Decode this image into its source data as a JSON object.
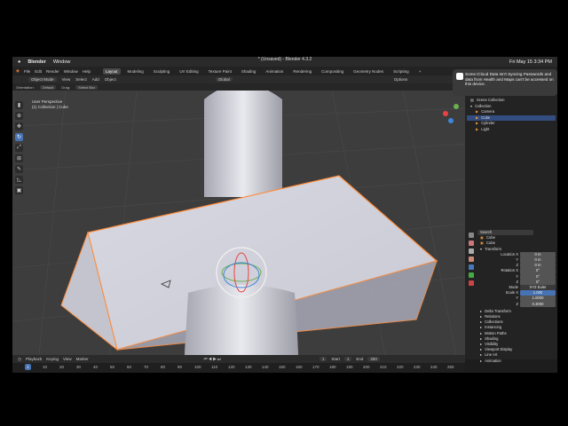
{
  "macbar": {
    "app": "Blender",
    "menu": [
      "Window"
    ],
    "clock": "Fri May 15  3:34 PM"
  },
  "window_title": "* (Unsaved) - Blender 4.3.2",
  "menus": [
    "File",
    "Edit",
    "Render",
    "Window",
    "Help"
  ],
  "workspaces": [
    "Layout",
    "Modeling",
    "Sculpting",
    "UV Editing",
    "Texture Paint",
    "Shading",
    "Animation",
    "Rendering",
    "Compositing",
    "Geometry Nodes",
    "Scripting",
    "+"
  ],
  "active_workspace": "Layout",
  "header": {
    "mode": "Object Mode",
    "view": "View",
    "select": "Select",
    "add": "Add",
    "object": "Object",
    "transform": "Global",
    "options": "Options"
  },
  "header2": {
    "orientation": "Orientation:",
    "orientation_val": "Default",
    "drag": "Drag:",
    "drag_val": "Select Box"
  },
  "viewport": {
    "line1": "User Perspective",
    "line2": "(1) Collection | Cube"
  },
  "notification": {
    "text": "Some iCloud Data Isn't Syncing Passwords and data from Health and Maps can't be accessed on this device."
  },
  "outliner": {
    "header": "Scene Collection",
    "items": [
      {
        "name": "Collection",
        "indent": 0
      },
      {
        "name": "Camera",
        "indent": 1
      },
      {
        "name": "Cube",
        "indent": 1,
        "selected": true
      },
      {
        "name": "Cylinder",
        "indent": 1
      },
      {
        "name": "Light",
        "indent": 1
      }
    ]
  },
  "properties": {
    "search_placeholder": "Search",
    "object_name": "Cube",
    "object_name2": "Cube",
    "transform": "Transform",
    "location": {
      "label": "Location X",
      "x": "0 m",
      "y": "0 m",
      "z": "0 m"
    },
    "rotation": {
      "label": "Rotation X",
      "x": "0°",
      "y": "0°",
      "z": "0°"
    },
    "mode": {
      "label": "Mode",
      "value": "XYZ Euler"
    },
    "scale": {
      "label": "Scale X",
      "x": "1.000",
      "y": "1.0000",
      "z": "0.3000"
    },
    "sections": [
      "Delta Transform",
      "Relations",
      "Collections",
      "Instancing",
      "Motion Paths",
      "Shading",
      "Visibility",
      "Viewport Display",
      "Line Art",
      "Animation"
    ]
  },
  "timeline": {
    "menu": [
      "Playback",
      "Keying",
      "View",
      "Marker"
    ],
    "current": "1",
    "start_label": "Start",
    "start": "1",
    "end_label": "End",
    "end": "250",
    "ticks": [
      "10",
      "20",
      "30",
      "40",
      "50",
      "60",
      "70",
      "80",
      "90",
      "100",
      "110",
      "120",
      "130",
      "140",
      "150",
      "160",
      "170",
      "180",
      "190",
      "200",
      "210",
      "220",
      "230",
      "240",
      "250"
    ]
  },
  "colors": {
    "accent": "#4772b3",
    "selection_outline": "#ff8c3a",
    "viewport_bg": "#3d3d3d"
  }
}
